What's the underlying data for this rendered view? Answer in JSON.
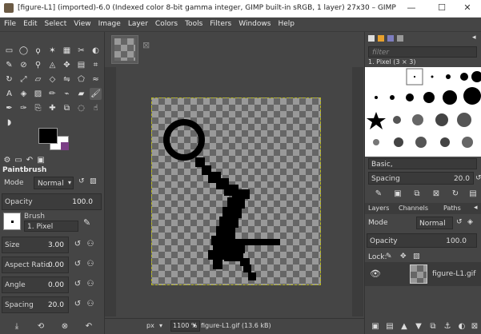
{
  "window": {
    "title": "[figure-L1] (imported)-6.0 (Indexed color 8-bit gamma integer, GIMP built-in sRGB, 1 layer) 27x30 – GIMP",
    "minimize": "—",
    "maximize": "☐",
    "close": "✕"
  },
  "menu": [
    "File",
    "Edit",
    "Select",
    "View",
    "Image",
    "Layer",
    "Colors",
    "Tools",
    "Filters",
    "Windows",
    "Help"
  ],
  "tool_options": {
    "title": "Paintbrush",
    "mode_label": "Mode",
    "mode_value": "Normal",
    "opacity_label": "Opacity",
    "opacity_value": "100.0",
    "brush_label": "Brush",
    "brush_value": "1. Pixel",
    "size_label": "Size",
    "size_value": "3.00",
    "aspect_label": "Aspect Ratio",
    "aspect_value": "0.00",
    "angle_label": "Angle",
    "angle_value": "0.00",
    "spacing_label": "Spacing",
    "spacing_value": "20.0"
  },
  "brushes": {
    "filter_placeholder": "filter",
    "selected_label": "1. Pixel (3 × 3)",
    "preset": "Basic,",
    "spacing_label": "Spacing",
    "spacing_value": "20.0"
  },
  "layers": {
    "tabs": [
      "Layers",
      "Channels",
      "Paths"
    ],
    "mode_label": "Mode",
    "mode_value": "Normal",
    "opacity_label": "Opacity",
    "opacity_value": "100.0",
    "lock_label": "Lock:",
    "layer_name": "figure-L1.gif"
  },
  "status": {
    "unit": "px",
    "zoom": "1100 %",
    "info": "figure-L1.gif (13.6 kB)"
  },
  "colors": {
    "accent": "#b9b920",
    "fg": "#000000",
    "bg": "#ffffff"
  }
}
